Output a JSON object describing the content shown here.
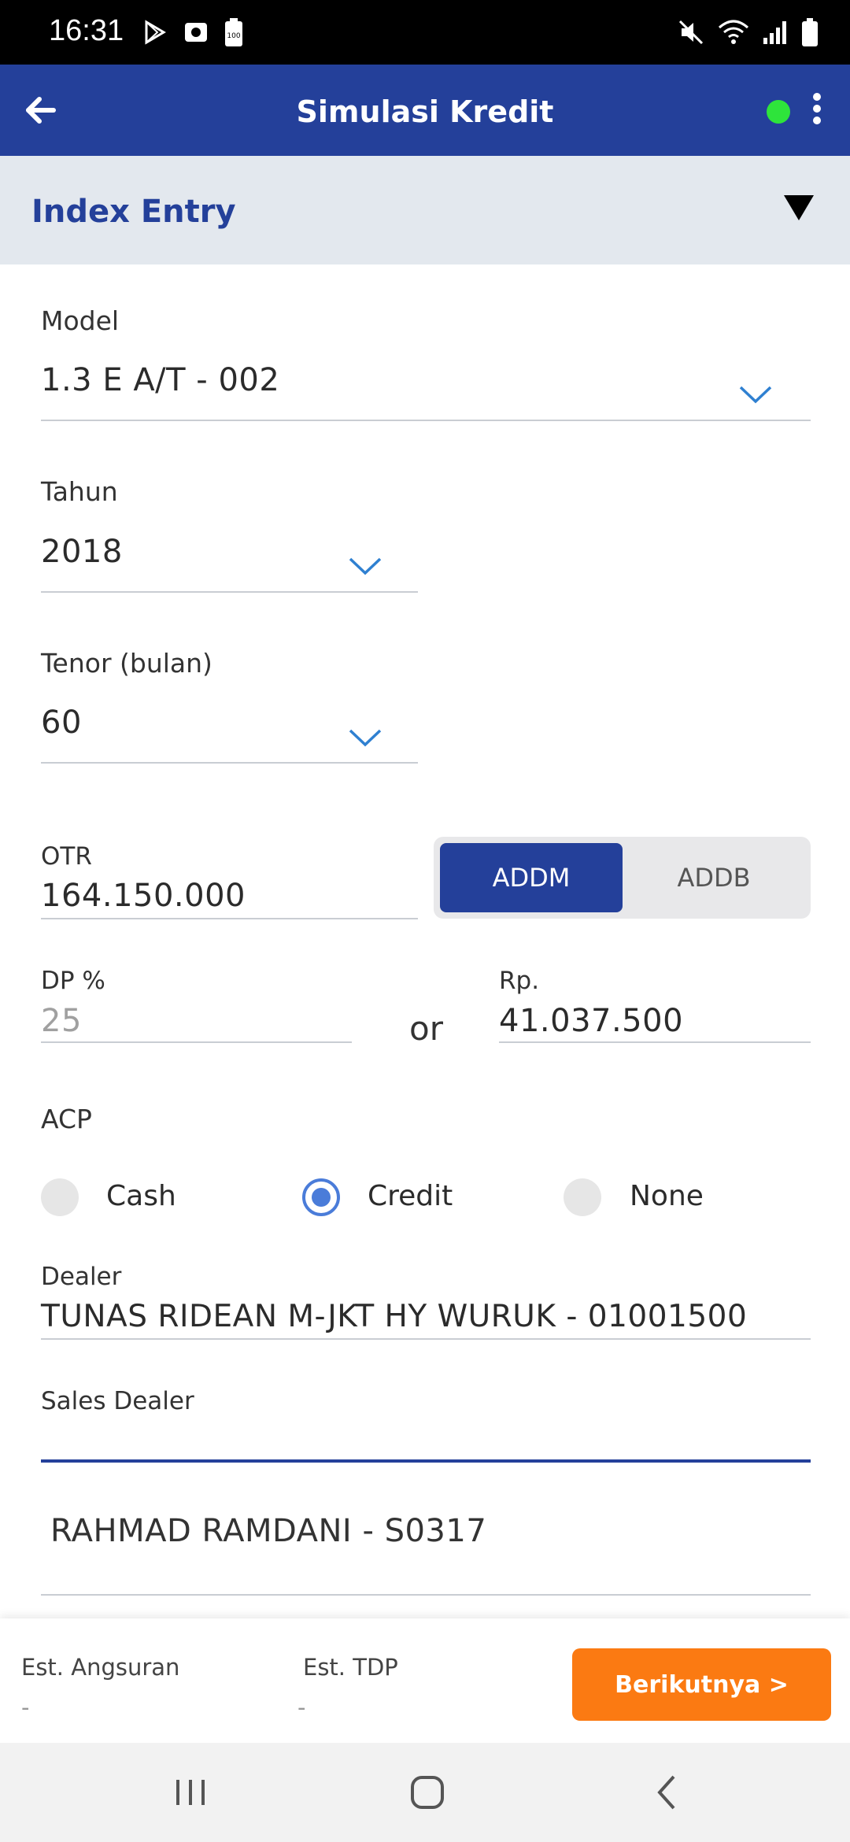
{
  "status_bar": {
    "time": "16:31",
    "left_icons": [
      "play-store-icon",
      "camera-app-icon",
      "battery-saver-icon"
    ],
    "right_icons": [
      "mute-icon",
      "wifi-icon",
      "signal-icon",
      "battery-icon"
    ],
    "battery_badge": "100"
  },
  "app_bar": {
    "title": "Simulasi Kredit",
    "online_color": "#2ee43b",
    "brand_color": "#24409a"
  },
  "section": {
    "title": "Index Entry"
  },
  "form": {
    "model": {
      "label": "Model",
      "value": "1.3 E A/T - 002"
    },
    "tahun": {
      "label": "Tahun",
      "value": "2018"
    },
    "tenor": {
      "label": "Tenor (bulan)",
      "value": "60"
    },
    "otr": {
      "label": "OTR",
      "value": "164.150.000"
    },
    "addm_toggle": {
      "options": [
        "ADDM",
        "ADDB"
      ],
      "selected": "ADDM"
    },
    "dp_percent": {
      "label": "DP %",
      "placeholder": "25"
    },
    "or_text": "or",
    "dp_rp": {
      "label": "Rp.",
      "value": "41.037.500"
    },
    "acp": {
      "label": "ACP",
      "options": [
        "Cash",
        "Credit",
        "None"
      ],
      "selected": "Credit"
    },
    "dealer": {
      "label": "Dealer",
      "value": "TUNAS RIDEAN M-JKT HY WURUK - 01001500"
    },
    "sales_dealer": {
      "label": "Sales Dealer",
      "value": "",
      "suggestion": "RAHMAD RAMDANI - S0317"
    }
  },
  "bottom_bar": {
    "est_angsuran_label": "Est. Angsuran",
    "est_angsuran_value": "-",
    "est_tdp_label": "Est. TDP",
    "est_tdp_value": "-",
    "next_label": "Berikutnya >",
    "accent_color": "#fb7a12"
  }
}
